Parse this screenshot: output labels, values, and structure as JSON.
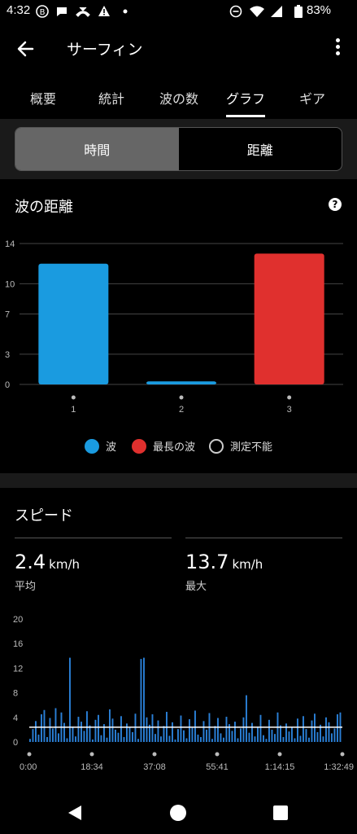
{
  "status_bar": {
    "time": "4:32",
    "battery": "83%",
    "icons_left": [
      "ai-badge-icon",
      "chat-icon",
      "missed-call-icon",
      "warning-icon",
      "dot-icon"
    ],
    "icons_right": [
      "dnd-icon",
      "wifi-icon",
      "signal-icon",
      "battery-icon"
    ]
  },
  "app_bar": {
    "title": "サーフィン"
  },
  "tabs": [
    {
      "label": "概要"
    },
    {
      "label": "統計"
    },
    {
      "label": "波の数"
    },
    {
      "label": "グラフ",
      "active": true
    },
    {
      "label": "ギア"
    }
  ],
  "segment": {
    "left": "時間",
    "right": "距離",
    "selected": "時間"
  },
  "wave_card": {
    "title": "波の距離",
    "legend": [
      {
        "label": "波",
        "color": "#1a9be0"
      },
      {
        "label": "最長の波",
        "color": "#e0302e"
      },
      {
        "label": "測定不能",
        "color": "#000000"
      }
    ]
  },
  "speed_card": {
    "title": "スピード",
    "avg": {
      "value": "2.4",
      "unit": "km/h",
      "label": "平均"
    },
    "max": {
      "value": "13.7",
      "unit": "km/h",
      "label": "最大"
    }
  },
  "chart_data": [
    {
      "type": "bar",
      "categories": [
        "1",
        "2",
        "3"
      ],
      "values": [
        12,
        0.3,
        13
      ],
      "colors": [
        "#1a9be0",
        "#1a9be0",
        "#e0302e"
      ],
      "ylim": [
        0,
        14
      ],
      "yticks": [
        "0",
        "3",
        "7",
        "10",
        "14"
      ],
      "grid": true
    },
    {
      "type": "bar",
      "xticks": [
        "0:00",
        "18:34",
        "37:08",
        "55:41",
        "1:14:15",
        "1:32:49"
      ],
      "yticks": [
        "0",
        "4",
        "8",
        "12",
        "16",
        "20"
      ],
      "ylim": [
        0,
        20
      ],
      "average_line": 2.4,
      "max": 13.7,
      "color": "#2a7fd6",
      "values": [
        0.5,
        2.1,
        3.4,
        1.2,
        4.5,
        5.2,
        0.8,
        3.9,
        2.2,
        5.5,
        1.4,
        4.8,
        3.1,
        0.6,
        13.7,
        2.5,
        0.9,
        4.1,
        3.3,
        1.8,
        5.0,
        2.7,
        0.4,
        3.6,
        4.4,
        1.1,
        2.9,
        0.7,
        5.3,
        3.8,
        2.0,
        1.5,
        4.2,
        0.8,
        3.0,
        2.4,
        1.6,
        4.6,
        0.5,
        13.5,
        13.7,
        4.0,
        2.8,
        4.5,
        1.3,
        3.5,
        0.9,
        2.6,
        4.9,
        1.0,
        3.2,
        0.4,
        2.1,
        4.3,
        1.9,
        0.6,
        3.7,
        2.3,
        5.1,
        1.2,
        0.8,
        3.4,
        2.0,
        4.7,
        0.5,
        2.6,
        3.9,
        1.4,
        0.7,
        4.1,
        2.9,
        1.8,
        3.3,
        0.6,
        2.2,
        4.0,
        7.6,
        1.5,
        3.1,
        0.9,
        2.5,
        4.4,
        1.1,
        0.5,
        3.6,
        2.0,
        1.3,
        4.8,
        2.7,
        0.8,
        3.0,
        1.7,
        2.4,
        0.6,
        3.8,
        1.0,
        4.2,
        2.1,
        0.7,
        3.5,
        4.6,
        1.6,
        2.8,
        0.9,
        4.0,
        3.2,
        1.4,
        2.2,
        4.5,
        4.8
      ]
    }
  ]
}
